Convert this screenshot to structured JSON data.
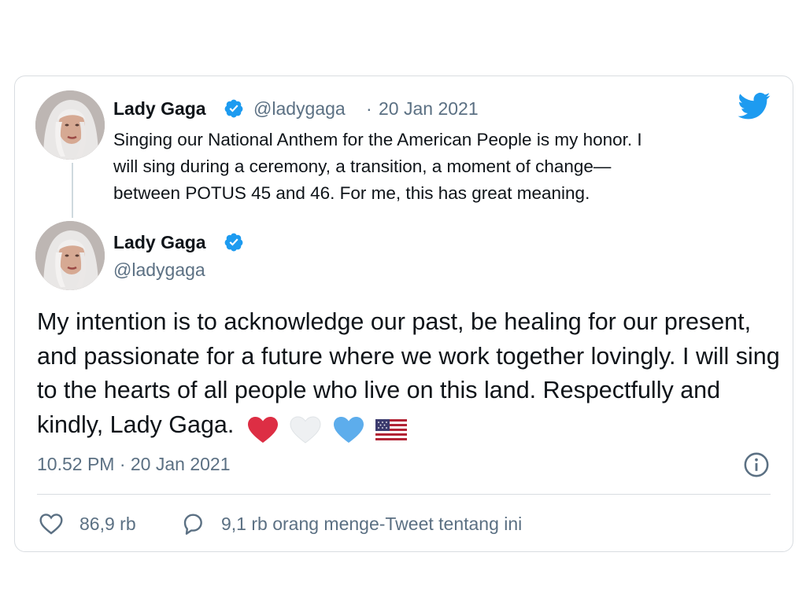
{
  "quoted_tweet": {
    "author_name": "Lady Gaga",
    "handle": "@ladygaga",
    "separator": "·",
    "date": "20 Jan 2021",
    "text": "Singing our National Anthem for the  American People is my honor.  I\nwill sing during a ceremony, a transition, a moment of change—\nbetween POTUS 45 and 46.  For me, this has great meaning."
  },
  "main_tweet": {
    "author_name": "Lady Gaga",
    "handle": "@ladygaga",
    "text": "My intention is to acknowledge our past, be healing for our present, and passionate for a future where we work together lovingly. I will sing to the hearts of all people who live on this land. Respectfully and kindly, Lady Gaga.",
    "emojis": [
      "red-heart-icon",
      "white-heart-icon",
      "blue-heart-icon",
      "us-flag-icon"
    ],
    "timestamp": "10.52 PM · 20 Jan 2021"
  },
  "actions": {
    "likes": "86,9 rb",
    "retweets_text": "9,1 rb orang menge-Tweet tentang ini"
  },
  "colors": {
    "twitter_blue": "#1d9bf0",
    "secondary_text": "#5b7083",
    "primary_text": "#0f1419",
    "border": "#d9dde1"
  }
}
